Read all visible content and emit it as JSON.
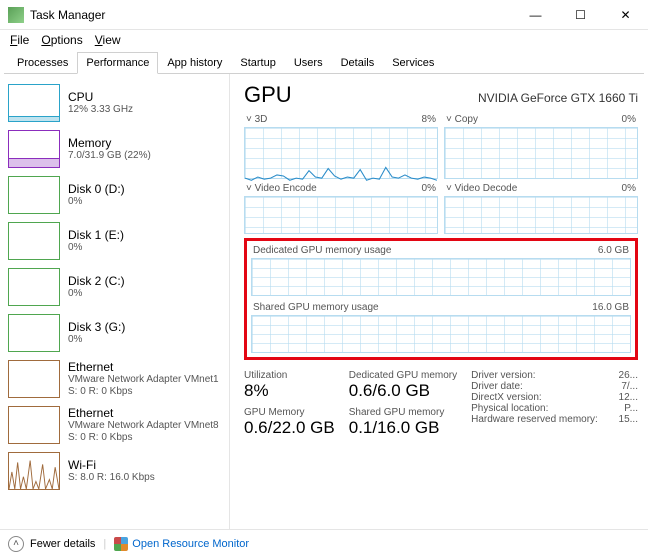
{
  "window": {
    "title": "Task Manager",
    "min": "—",
    "max": "☐",
    "close": "✕"
  },
  "menu": {
    "file": "File",
    "options": "Options",
    "view": "View"
  },
  "tabs": [
    "Processes",
    "Performance",
    "App history",
    "Startup",
    "Users",
    "Details",
    "Services"
  ],
  "sidebar": [
    {
      "title": "CPU",
      "sub": "12% 3.33 GHz",
      "cls": "cpu"
    },
    {
      "title": "Memory",
      "sub": "7.0/31.9 GB (22%)",
      "cls": "memory"
    },
    {
      "title": "Disk 0 (D:)",
      "sub": "0%",
      "cls": "disk"
    },
    {
      "title": "Disk 1 (E:)",
      "sub": "0%",
      "cls": "disk"
    },
    {
      "title": "Disk 2 (C:)",
      "sub": "0%",
      "cls": "disk"
    },
    {
      "title": "Disk 3 (G:)",
      "sub": "0%",
      "cls": "disk"
    },
    {
      "title": "Ethernet",
      "sub": "VMware Network Adapter VMnet1",
      "sub2": "S: 0  R: 0 Kbps",
      "cls": "eth"
    },
    {
      "title": "Ethernet",
      "sub": "VMware Network Adapter VMnet8",
      "sub2": "S: 0  R: 0 Kbps",
      "cls": "eth"
    },
    {
      "title": "Wi-Fi",
      "sub": "S: 8.0  R: 16.0 Kbps",
      "cls": "wifi"
    }
  ],
  "gpu": {
    "title": "GPU",
    "name": "NVIDIA GeForce GTX 1660 Ti",
    "charts": {
      "c0": {
        "label": "3D",
        "pct": "8%"
      },
      "c1": {
        "label": "Copy",
        "pct": "0%"
      },
      "c2": {
        "label": "Video Encode",
        "pct": "0%"
      },
      "c3": {
        "label": "Video Decode",
        "pct": "0%"
      }
    },
    "dedicated": {
      "label": "Dedicated GPU memory usage",
      "max": "6.0 GB"
    },
    "shared": {
      "label": "Shared GPU memory usage",
      "max": "16.0 GB"
    },
    "stats": {
      "util_l": "Utilization",
      "util_v": "8%",
      "gmem_l": "GPU Memory",
      "gmem_v": "0.6/22.0 GB",
      "ded_l": "Dedicated GPU memory",
      "ded_v": "0.6/6.0 GB",
      "shr_l": "Shared GPU memory",
      "shr_v": "0.1/16.0 GB"
    },
    "driver": {
      "r0l": "Driver version:",
      "r0v": "26...",
      "r1l": "Driver date:",
      "r1v": "7/...",
      "r2l": "DirectX version:",
      "r2v": "12...",
      "r3l": "Physical location:",
      "r3v": "P...",
      "r4l": "Hardware reserved memory:",
      "r4v": "15..."
    }
  },
  "footer": {
    "fewer": "Fewer details",
    "openrm": "Open Resource Monitor"
  },
  "chart_data": {
    "type": "line",
    "title": "GPU usage",
    "series": [
      {
        "name": "3D",
        "unit": "%",
        "ylim": [
          0,
          100
        ],
        "values": [
          5,
          3,
          6,
          4,
          5,
          8,
          7,
          3,
          5,
          4,
          12,
          6,
          5,
          14,
          7,
          4,
          6,
          5,
          13,
          3,
          5,
          4,
          15,
          6,
          5,
          8,
          5,
          4,
          6,
          5,
          3,
          8,
          4,
          5,
          6,
          4,
          5,
          8,
          6,
          5
        ]
      },
      {
        "name": "Copy",
        "unit": "%",
        "ylim": [
          0,
          100
        ],
        "values": [
          0,
          0,
          0,
          0,
          0,
          0,
          0,
          0,
          0,
          0,
          0,
          0,
          0,
          0,
          0,
          0,
          0,
          0,
          0,
          0
        ]
      },
      {
        "name": "Video Encode",
        "unit": "%",
        "ylim": [
          0,
          100
        ],
        "values": [
          0,
          0,
          0,
          0,
          0,
          0,
          0,
          0,
          0,
          0,
          0,
          0,
          0,
          0,
          0,
          0,
          0,
          0,
          0,
          0
        ]
      },
      {
        "name": "Video Decode",
        "unit": "%",
        "ylim": [
          0,
          100
        ],
        "values": [
          0,
          0,
          0,
          0,
          0,
          0,
          0,
          0,
          0,
          0,
          0,
          0,
          0,
          0,
          0,
          0,
          0,
          0,
          0,
          0
        ]
      },
      {
        "name": "Dedicated GPU memory usage",
        "unit": "GB",
        "ylim": [
          0,
          6.0
        ],
        "values": [
          0.6,
          0.6,
          0.6,
          0.6,
          0.6,
          0.6,
          0.6,
          0.6,
          0.6,
          0.6
        ]
      },
      {
        "name": "Shared GPU memory usage",
        "unit": "GB",
        "ylim": [
          0,
          16.0
        ],
        "values": [
          0.1,
          0.1,
          0.1,
          0.1,
          0.1,
          0.1,
          0.1,
          0.1,
          0.1,
          0.1
        ]
      }
    ]
  }
}
